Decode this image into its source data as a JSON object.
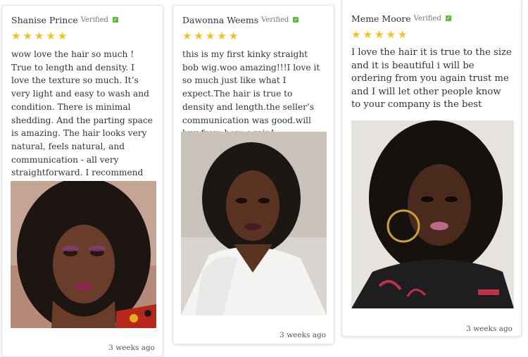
{
  "reviews": [
    {
      "name": "Shanise Prince",
      "verified_label": "Verified",
      "rating": 5,
      "stars": "★★★★★",
      "text": "wow love the hair so much ! True to length and density. I love the texture so much. It’s very light and easy to wash and condition. There is minimal shedding. And the parting space is amazing. The hair looks very natural, feels natural, and communication - all very straightforward. I recommend the seller.",
      "date": "3 weeks ago"
    },
    {
      "name": "Dawonna Weems",
      "verified_label": "Verified",
      "rating": 5,
      "stars": "★★★★★",
      "text": "this is my first kinky straight bob wig.woo amazing!!!I love it so much just like what I expect.The hair is true to density and length.the seller’s communication was good.will buy from here again!",
      "date": "3 weeks ago"
    },
    {
      "name": "Meme Moore",
      "verified_label": "Verified",
      "rating": 5,
      "stars": "★★★★★",
      "text": "I love the hair it is true to the size and it is beautiful i will be ordering from you again trust me and I will let other people know to your company is the best",
      "date": "3 weeks ago"
    }
  ],
  "colors": {
    "star": "#f3c416",
    "verified_check": "#5bbf3a",
    "card_border": "#e3e3e3"
  },
  "icons": {
    "verified": "verified-check-icon",
    "star": "star-icon"
  }
}
